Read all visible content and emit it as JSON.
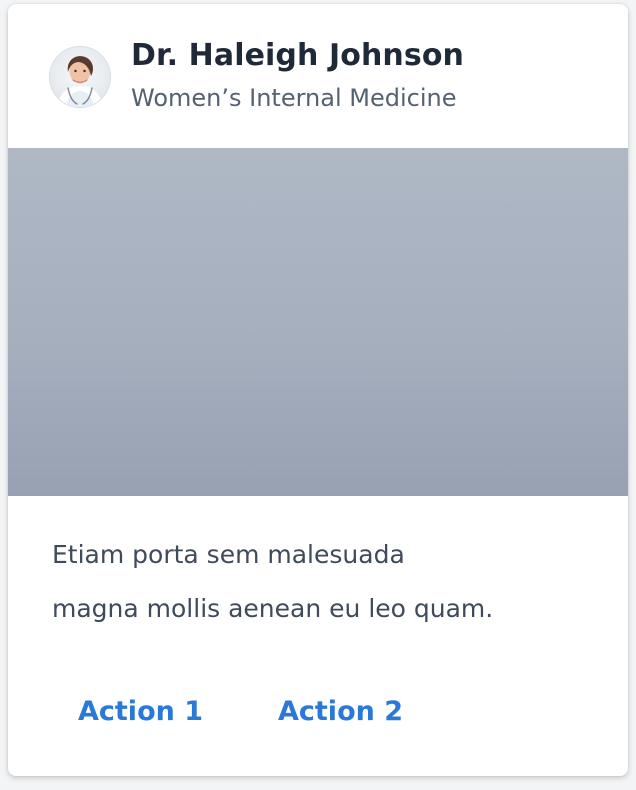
{
  "card": {
    "header": {
      "name": "Dr. Haleigh Johnson",
      "subtitle": "Women’s Internal Medicine",
      "avatar_icon": "doctor-avatar"
    },
    "body": {
      "text_line_1": "Etiam porta sem malesuada",
      "text_line_2": "magna mollis aenean eu leo quam."
    },
    "actions": [
      {
        "label": "Action 1"
      },
      {
        "label": "Action 2"
      }
    ]
  },
  "colors": {
    "accent": "#2a78d7",
    "title": "#1f2937",
    "subtitle": "#556272",
    "body": "#3f4a5a",
    "media_top": "#b0b8c6",
    "media_bottom": "#97a1b2"
  }
}
